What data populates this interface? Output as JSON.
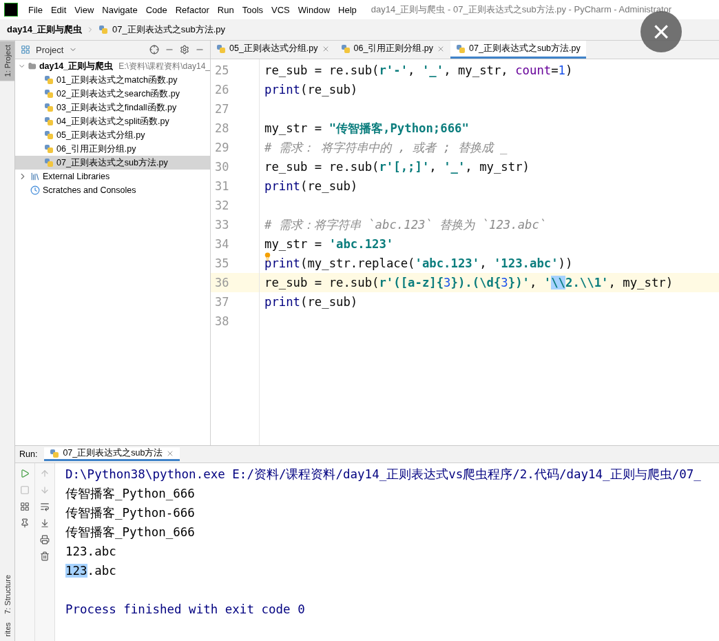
{
  "window": {
    "title": "day14_正则与爬虫 - 07_正则表达式之sub方法.py - PyCharm - Administrator"
  },
  "menu": [
    "File",
    "Edit",
    "View",
    "Navigate",
    "Code",
    "Refactor",
    "Run",
    "Tools",
    "VCS",
    "Window",
    "Help"
  ],
  "breadcrumb": [
    "day14_正则与爬虫",
    "07_正则表达式之sub方法.py"
  ],
  "left_strip": [
    {
      "label": "1: Project",
      "selected": true
    },
    {
      "label": "7: Structure",
      "selected": false
    },
    {
      "label": "rites",
      "selected": false
    }
  ],
  "project_panel": {
    "title": "Project",
    "tree": [
      {
        "label": "day14_正则与爬虫",
        "hint": "E:\\资料\\课程资料\\day14_",
        "kind": "folder",
        "expanded": true,
        "selected": false,
        "children": [
          {
            "label": "01_正则表达式之match函数.py",
            "kind": "python",
            "selected": false
          },
          {
            "label": "02_正则表达式之search函数.py",
            "kind": "python",
            "selected": false
          },
          {
            "label": "03_正则表达式之findall函数.py",
            "kind": "python",
            "selected": false
          },
          {
            "label": "04_正则表达式之split函数.py",
            "kind": "python",
            "selected": false
          },
          {
            "label": "05_正则表达式分组.py",
            "kind": "python",
            "selected": false
          },
          {
            "label": "06_引用正则分组.py",
            "kind": "python",
            "selected": false
          },
          {
            "label": "07_正则表达式之sub方法.py",
            "kind": "python",
            "selected": true
          }
        ]
      },
      {
        "label": "External Libraries",
        "kind": "libraries",
        "expanded": false,
        "selected": false
      },
      {
        "label": "Scratches and Consoles",
        "kind": "scratches",
        "selected": false
      }
    ]
  },
  "editor_tabs": [
    {
      "label": "05_正则表达式分组.py",
      "selected": false
    },
    {
      "label": "06_引用正则分组.py",
      "selected": false
    },
    {
      "label": "07_正则表达式之sub方法.py",
      "selected": true
    }
  ],
  "code_lines": [
    {
      "number": "25",
      "current": false,
      "tokens": [
        {
          "kind": "text",
          "text": "re_sub = re.sub("
        },
        {
          "kind": "string",
          "text": "r'-'"
        },
        {
          "kind": "text",
          "text": ", "
        },
        {
          "kind": "string",
          "text": "'_'"
        },
        {
          "kind": "text",
          "text": ", my_str, "
        },
        {
          "kind": "keyword_arg",
          "text": "count"
        },
        {
          "kind": "text",
          "text": "="
        },
        {
          "kind": "number",
          "text": "1"
        },
        {
          "kind": "text",
          "text": ")"
        }
      ]
    },
    {
      "number": "26",
      "current": false,
      "tokens": [
        {
          "kind": "builtin",
          "text": "print"
        },
        {
          "kind": "text",
          "text": "(re_sub)"
        }
      ]
    },
    {
      "number": "27",
      "current": false
    },
    {
      "number": "28",
      "current": false,
      "tokens": [
        {
          "kind": "text",
          "text": "my_str = "
        },
        {
          "kind": "string",
          "text": "\"传智播客,Python;666\""
        }
      ]
    },
    {
      "number": "29",
      "current": false,
      "tokens": [
        {
          "kind": "comment",
          "text": "# 需求： 将字符串中的 , 或者 ; 替换成 _"
        }
      ]
    },
    {
      "number": "30",
      "current": false,
      "tokens": [
        {
          "kind": "text",
          "text": "re_sub = re.sub("
        },
        {
          "kind": "string",
          "text": "r'[,;]'"
        },
        {
          "kind": "text",
          "text": ", "
        },
        {
          "kind": "string",
          "text": "'_'"
        },
        {
          "kind": "text",
          "text": ", my_str)"
        }
      ]
    },
    {
      "number": "31",
      "current": false,
      "tokens": [
        {
          "kind": "builtin",
          "text": "print"
        },
        {
          "kind": "text",
          "text": "(re_sub)"
        }
      ]
    },
    {
      "number": "32",
      "current": false
    },
    {
      "number": "33",
      "current": false,
      "tokens": [
        {
          "kind": "comment",
          "text": "# 需求：将字符串 `abc.123` 替换为 `123.abc`"
        }
      ]
    },
    {
      "number": "34",
      "current": false,
      "tokens": [
        {
          "kind": "text",
          "text": "my_str = "
        },
        {
          "kind": "string",
          "text": "'abc.123'"
        }
      ]
    },
    {
      "number": "35",
      "current": false,
      "tokens": [
        {
          "kind": "builtin",
          "text": "print"
        },
        {
          "kind": "text",
          "text": "(my_str.replace("
        },
        {
          "kind": "string",
          "text": "'abc.123'"
        },
        {
          "kind": "text",
          "text": ", "
        },
        {
          "kind": "string",
          "text": "'123.abc'"
        },
        {
          "kind": "text",
          "text": "))"
        }
      ]
    },
    {
      "number": "36",
      "current": true,
      "tokens": [
        {
          "kind": "text",
          "text": "re_sub = re.sub("
        },
        {
          "kind": "string",
          "text": "r'([a-z]{"
        },
        {
          "kind": "number",
          "text": "3"
        },
        {
          "kind": "string",
          "text": "}).(\\d{"
        },
        {
          "kind": "number",
          "text": "3"
        },
        {
          "kind": "string",
          "text": "})'"
        },
        {
          "kind": "text",
          "text": ", "
        },
        {
          "kind": "string",
          "text": "'"
        },
        {
          "kind": "selection",
          "text": "\\\\"
        },
        {
          "kind": "string",
          "text": "2.\\\\1'"
        },
        {
          "kind": "text",
          "text": ", my_str)"
        }
      ]
    },
    {
      "number": "37",
      "current": false,
      "tokens": [
        {
          "kind": "builtin",
          "text": "print"
        },
        {
          "kind": "text",
          "text": "(re_sub)"
        }
      ]
    },
    {
      "number": "38",
      "current": false
    }
  ],
  "run_panel": {
    "label": "Run:",
    "tab": "07_正则表达式之sub方法",
    "lines": [
      {
        "kind": "system",
        "tokens": [
          {
            "kind": "text",
            "text": "D:\\Python38\\python.exe E:/资料/课程资料/day14_正则表达式vs爬虫程序/2.代码/day14_正则与爬虫/07_"
          }
        ]
      },
      {
        "kind": "output",
        "tokens": [
          {
            "kind": "text",
            "text": "传智播客_Python_666"
          }
        ]
      },
      {
        "kind": "output",
        "tokens": [
          {
            "kind": "text",
            "text": "传智播客_Python-666"
          }
        ]
      },
      {
        "kind": "output",
        "tokens": [
          {
            "kind": "text",
            "text": "传智播客_Python_666"
          }
        ]
      },
      {
        "kind": "output",
        "tokens": [
          {
            "kind": "text",
            "text": "123.abc"
          }
        ]
      },
      {
        "kind": "output",
        "tokens": [
          {
            "kind": "selection",
            "text": "123"
          },
          {
            "kind": "text",
            "text": ".abc"
          }
        ]
      },
      {
        "kind": "blank"
      },
      {
        "kind": "system",
        "tokens": [
          {
            "kind": "text",
            "text": "Process finished with exit code 0"
          }
        ]
      }
    ]
  },
  "overlay": {
    "close_button": "×"
  }
}
